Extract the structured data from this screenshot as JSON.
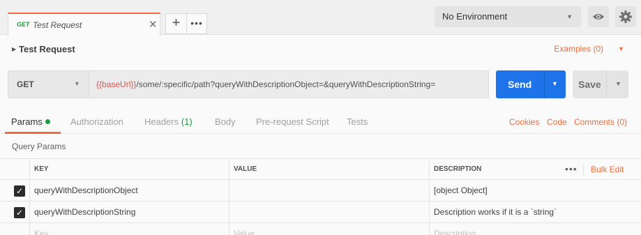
{
  "request_tab": {
    "method": "GET",
    "name": "Test Request",
    "close_glyph": "✕"
  },
  "tab_controls": {
    "add_glyph": "+",
    "more_glyph": "•••"
  },
  "environment": {
    "selected": "No Environment"
  },
  "request": {
    "title": "Test Request",
    "examples_label": "Examples (0)",
    "method": "GET",
    "url_variable": "{{baseUrl}}",
    "url_rest": "/some/:specific/path?queryWithDescriptionObject=&queryWithDescriptionString="
  },
  "buttons": {
    "send": "Send",
    "save": "Save"
  },
  "subtabs": {
    "params": "Params",
    "authorization": "Authorization",
    "headers": "Headers",
    "headers_count": "(1)",
    "body": "Body",
    "pre_request": "Pre-request Script",
    "tests": "Tests",
    "cookies": "Cookies",
    "code": "Code",
    "comments": "Comments (0)"
  },
  "query_params": {
    "title": "Query Params",
    "columns": {
      "key": "KEY",
      "value": "VALUE",
      "description": "DESCRIPTION"
    },
    "more_glyph": "•••",
    "bulk_edit": "Bulk Edit",
    "rows": [
      {
        "checked": true,
        "key": "queryWithDescriptionObject",
        "value": "",
        "description": "[object Object]"
      },
      {
        "checked": true,
        "key": "queryWithDescriptionString",
        "value": "",
        "description": "Description works if it is a `string`"
      }
    ],
    "placeholder": {
      "key": "Key",
      "value": "Value",
      "description": "Description"
    }
  },
  "colors": {
    "accent": "#f26b3a",
    "send": "#1f73e8",
    "get": "#1a9f3d",
    "variable": "#e0504a"
  }
}
